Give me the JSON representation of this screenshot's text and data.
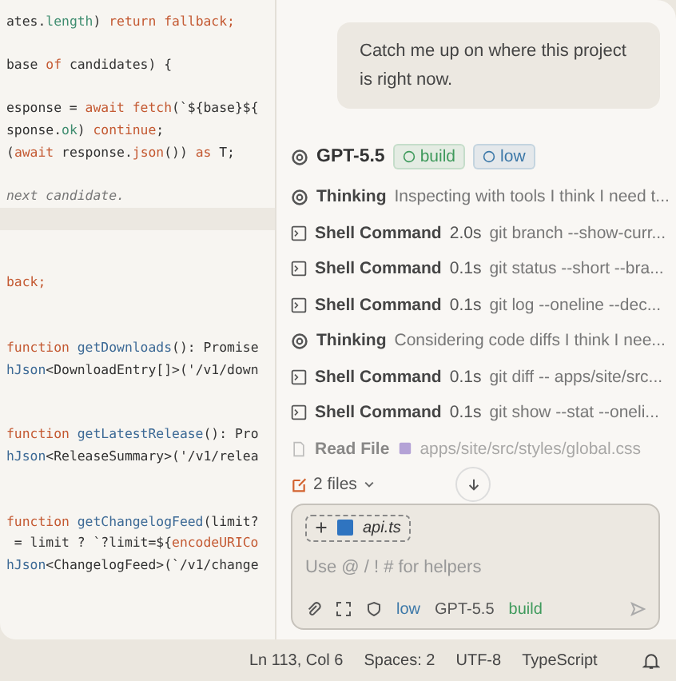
{
  "editor": {
    "lines": [
      {
        "kind": "code",
        "current": false,
        "tokens": [
          {
            "text": "ates.",
            "kind": "plain"
          },
          {
            "text": "length",
            "kind": "prop"
          },
          {
            "text": ") ",
            "kind": "plain"
          },
          {
            "text": "return",
            "kind": "keyword"
          },
          {
            "text": " fallback;",
            "kind": "keyword"
          }
        ]
      },
      {
        "kind": "blank"
      },
      {
        "kind": "code",
        "current": false,
        "tokens": [
          {
            "text": "base ",
            "kind": "plain"
          },
          {
            "text": "of",
            "kind": "keyword"
          },
          {
            "text": " candidates) {",
            "kind": "plain"
          }
        ]
      },
      {
        "kind": "blank"
      },
      {
        "kind": "code",
        "current": false,
        "tokens": [
          {
            "text": "esponse = ",
            "kind": "plain"
          },
          {
            "text": "await",
            "kind": "keyword"
          },
          {
            "text": " fetch",
            "kind": "keyword"
          },
          {
            "text": "(`${base}${",
            "kind": "plain"
          }
        ]
      },
      {
        "kind": "code",
        "current": false,
        "tokens": [
          {
            "text": "sponse.",
            "kind": "plain"
          },
          {
            "text": "ok",
            "kind": "prop"
          },
          {
            "text": ") ",
            "kind": "plain"
          },
          {
            "text": "continue",
            "kind": "keyword"
          },
          {
            "text": ";",
            "kind": "plain"
          }
        ]
      },
      {
        "kind": "code",
        "current": false,
        "tokens": [
          {
            "text": "(",
            "kind": "plain"
          },
          {
            "text": "await",
            "kind": "keyword"
          },
          {
            "text": " response.",
            "kind": "plain"
          },
          {
            "text": "json",
            "kind": "keyword"
          },
          {
            "text": "()) ",
            "kind": "plain"
          },
          {
            "text": "as",
            "kind": "keyword"
          },
          {
            "text": " T;",
            "kind": "plain"
          }
        ]
      },
      {
        "kind": "blank"
      },
      {
        "kind": "code",
        "current": false,
        "tokens": [
          {
            "text": "next candidate.",
            "kind": "comment"
          }
        ]
      },
      {
        "kind": "blank",
        "current": true
      },
      {
        "kind": "blank"
      },
      {
        "kind": "blank"
      },
      {
        "kind": "code",
        "current": false,
        "tokens": [
          {
            "text": "back;",
            "kind": "keyword"
          }
        ]
      },
      {
        "kind": "blank"
      },
      {
        "kind": "blank"
      },
      {
        "kind": "code",
        "current": false,
        "tokens": [
          {
            "text": "function",
            "kind": "keyword"
          },
          {
            "text": " getDownloads",
            "kind": "fn"
          },
          {
            "text": "(): Promise",
            "kind": "plain"
          }
        ]
      },
      {
        "kind": "code",
        "current": false,
        "tokens": [
          {
            "text": "hJson",
            "kind": "fn"
          },
          {
            "text": "<DownloadEntry[]>('/v1/down",
            "kind": "plain"
          }
        ]
      },
      {
        "kind": "blank"
      },
      {
        "kind": "blank"
      },
      {
        "kind": "code",
        "current": false,
        "tokens": [
          {
            "text": "function",
            "kind": "keyword"
          },
          {
            "text": " getLatestRelease",
            "kind": "fn"
          },
          {
            "text": "(): Pro",
            "kind": "plain"
          }
        ]
      },
      {
        "kind": "code",
        "current": false,
        "tokens": [
          {
            "text": "hJson",
            "kind": "fn"
          },
          {
            "text": "<ReleaseSummary>('/v1/relea",
            "kind": "plain"
          }
        ]
      },
      {
        "kind": "blank"
      },
      {
        "kind": "blank"
      },
      {
        "kind": "code",
        "current": false,
        "tokens": [
          {
            "text": "function",
            "kind": "keyword"
          },
          {
            "text": " getChangelogFeed",
            "kind": "fn"
          },
          {
            "text": "(limit?",
            "kind": "plain"
          }
        ]
      },
      {
        "kind": "code",
        "current": false,
        "tokens": [
          {
            "text": " = limit ? `?limit=${",
            "kind": "plain"
          },
          {
            "text": "encodeURICo",
            "kind": "keyword"
          }
        ]
      },
      {
        "kind": "code",
        "current": false,
        "tokens": [
          {
            "text": "hJson",
            "kind": "fn"
          },
          {
            "text": "<ChangelogFeed>(`/v1/change",
            "kind": "plain"
          }
        ]
      }
    ]
  },
  "chat": {
    "user_message": "Catch me up on where this project is right now.",
    "model": {
      "name": "GPT-5.5",
      "tags": [
        {
          "label": "build",
          "color": "#3f9a5c"
        },
        {
          "label": "low",
          "color": "#3c78a8"
        }
      ]
    },
    "activity": [
      {
        "kind": "thinking",
        "label": "Thinking",
        "detail": "Inspecting with tools I think I need t...",
        "faded": false
      },
      {
        "kind": "shell",
        "label": "Shell Command",
        "duration": "2.0s",
        "detail": "git branch --show-curr...",
        "faded": false
      },
      {
        "kind": "shell",
        "label": "Shell Command",
        "duration": "0.1s",
        "detail": "git status --short --bra...",
        "faded": false
      },
      {
        "kind": "shell",
        "label": "Shell Command",
        "duration": "0.1s",
        "detail": "git log --oneline --dec...",
        "faded": false
      },
      {
        "kind": "thinking",
        "label": "Thinking",
        "detail": "Considering code diffs I think I nee...",
        "faded": false
      },
      {
        "kind": "shell",
        "label": "Shell Command",
        "duration": "0.1s",
        "detail": "git diff -- apps/site/src...",
        "faded": false
      },
      {
        "kind": "shell",
        "label": "Shell Command",
        "duration": "0.1s",
        "detail": "git show --stat --oneli...",
        "faded": false
      },
      {
        "kind": "read",
        "label": "Read File",
        "detail": "apps/site/src/styles/global.css",
        "faded": true
      }
    ],
    "files": "2 files",
    "composer": {
      "attachment": "api.ts",
      "placeholder": "Use @ / ! # for helpers",
      "chips": [
        {
          "label": "low",
          "color": "#3c78a8"
        },
        {
          "label": "GPT-5.5",
          "color": "#555555"
        },
        {
          "label": "build",
          "color": "#3f9a5c"
        }
      ]
    }
  },
  "status_bar": {
    "position": "Ln 113, Col 6",
    "indent": "Spaces: 2",
    "encoding": "UTF-8",
    "language": "TypeScript"
  }
}
